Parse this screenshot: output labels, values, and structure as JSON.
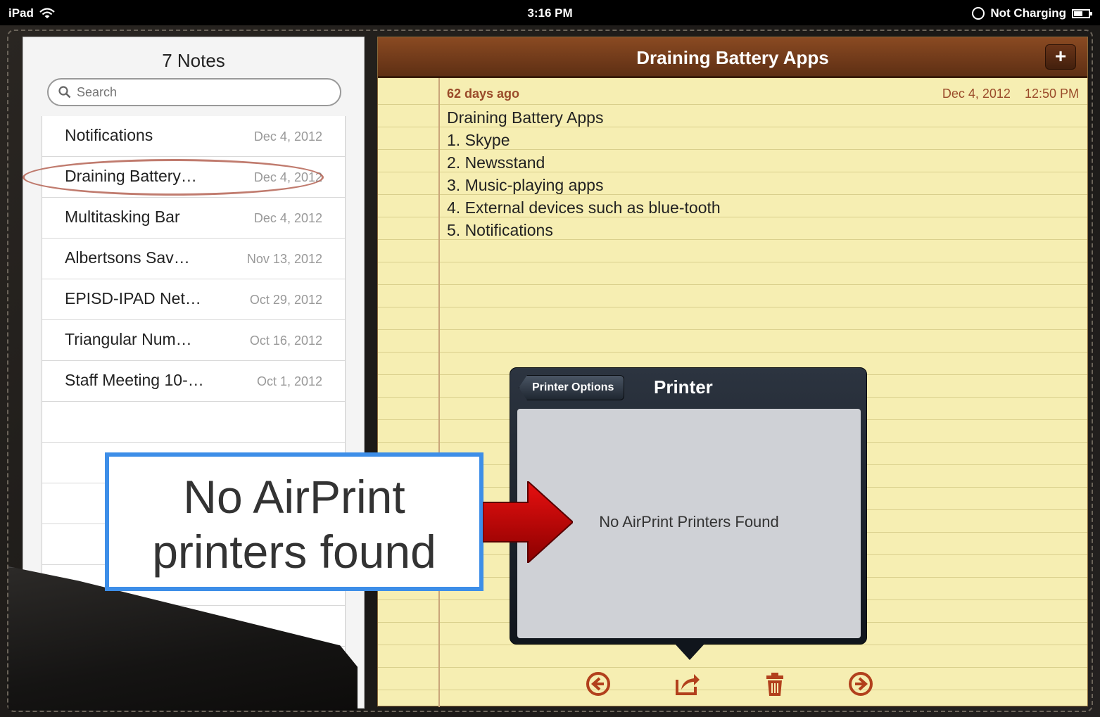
{
  "status_bar": {
    "device": "iPad",
    "time": "3:16 PM",
    "battery_text": "Not Charging"
  },
  "notes_list": {
    "title": "7 Notes",
    "search_placeholder": "Search",
    "items": [
      {
        "name": "Notifications",
        "date": "Dec 4, 2012"
      },
      {
        "name": "Draining Battery…",
        "date": "Dec 4, 2012"
      },
      {
        "name": "Multitasking Bar",
        "date": "Dec 4, 2012"
      },
      {
        "name": "Albertsons Sav…",
        "date": "Nov 13, 2012"
      },
      {
        "name": "EPISD-IPAD Net…",
        "date": "Oct 29, 2012"
      },
      {
        "name": "Triangular Num…",
        "date": "Oct 16, 2012"
      },
      {
        "name": "Staff Meeting 10-…",
        "date": "Oct 1, 2012"
      }
    ],
    "highlighted_index": 1
  },
  "note": {
    "title": "Draining Battery Apps",
    "add_label": "+",
    "age": "62 days ago",
    "date": "Dec 4, 2012",
    "time": "12:50 PM",
    "lines": [
      "Draining Battery Apps",
      "1.  Skype",
      "2.  Newsstand",
      "3.  Music-playing apps",
      "4.  External devices such as blue-tooth",
      "5.  Notifications"
    ]
  },
  "toolbar": {
    "icons": [
      "previous-icon",
      "share-icon",
      "trash-icon",
      "next-icon"
    ],
    "color": "#b2401c"
  },
  "popover": {
    "back_label": "Printer Options",
    "title": "Printer",
    "message": "No AirPrint Printers Found"
  },
  "annotation": {
    "line1": "No AirPrint",
    "line2": "printers found",
    "border_color": "#3d8ee8",
    "arrow_color": "#cc0000"
  }
}
